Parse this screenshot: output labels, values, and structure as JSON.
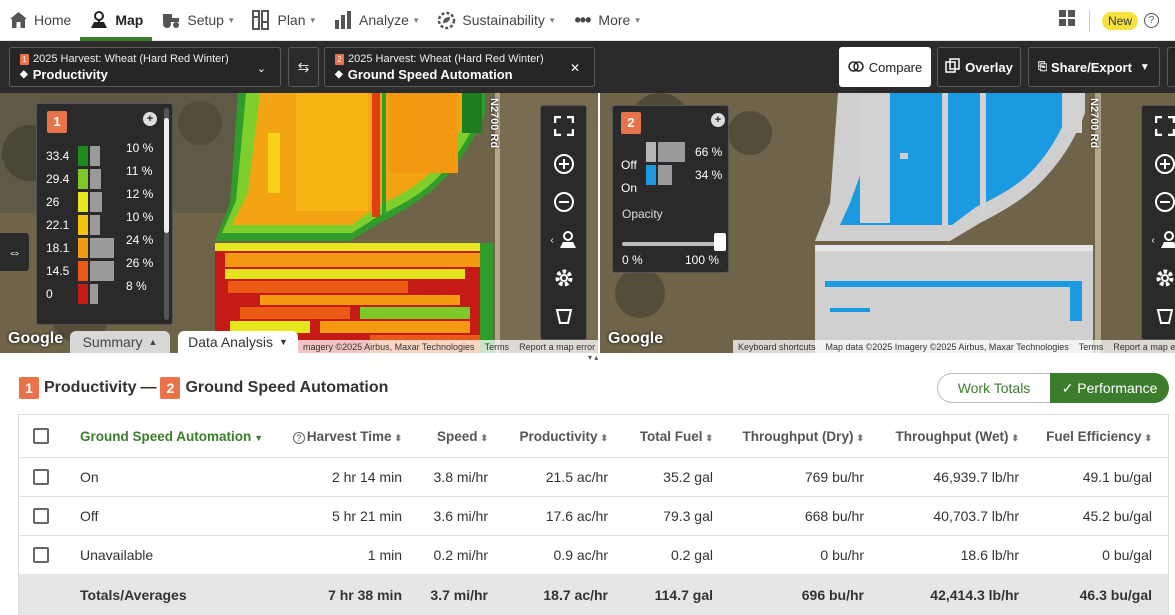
{
  "nav": {
    "items": [
      {
        "label": "Home",
        "icon": "home-icon"
      },
      {
        "label": "Map",
        "icon": "map-pin-icon"
      },
      {
        "label": "Setup",
        "icon": "tractor-icon"
      },
      {
        "label": "Plan",
        "icon": "columns-icon"
      },
      {
        "label": "Analyze",
        "icon": "bar-chart-icon"
      },
      {
        "label": "Sustainability",
        "icon": "leaf-gear-icon"
      },
      {
        "label": "More",
        "icon": "dots-icon"
      }
    ],
    "new_badge": "New"
  },
  "toolbar": {
    "layer1": {
      "num": "1",
      "title": "2025 Harvest: Wheat (Hard Red Winter)",
      "layer": "Productivity"
    },
    "layer2": {
      "num": "2",
      "title": "2025 Harvest: Wheat (Hard Red Winter)",
      "layer": "Ground Speed Automation"
    },
    "compare": "Compare",
    "overlay": "Overlay",
    "share": "Share/Export"
  },
  "map_left": {
    "legend_num": "1",
    "legend": [
      {
        "value": "33.4",
        "pct": "10 %",
        "color": "#1e8a1e",
        "fill": 0.42
      },
      {
        "value": "29.4",
        "pct": "11 %",
        "color": "#7ec82a",
        "fill": 0.46
      },
      {
        "value": "26",
        "pct": "12 %",
        "color": "#e6e61e",
        "fill": 0.5
      },
      {
        "value": "22.1",
        "pct": "10 %",
        "color": "#f2c20f",
        "fill": 0.42
      },
      {
        "value": "18.1",
        "pct": "24 %",
        "color": "#f39a12",
        "fill": 1.0
      },
      {
        "value": "14.5",
        "pct": "26 %",
        "color": "#ea5a14",
        "fill": 1.0
      },
      {
        "value": "0",
        "pct": "8 %",
        "color": "#c41b14",
        "fill": 0.33
      }
    ],
    "road": "N2700 Rd",
    "google": "Google",
    "attribution": [
      "magery ©2025 Airbus, Maxar Technologies",
      "Terms",
      "Report a map error"
    ]
  },
  "map_right": {
    "legend_num": "2",
    "legend": [
      {
        "label": "Off",
        "pct": "66 %",
        "color": "#b5b5b5",
        "fill": 1.0
      },
      {
        "label": "On",
        "pct": "34 %",
        "color": "#1a9ae0",
        "fill": 0.52
      }
    ],
    "opacity_label": "Opacity",
    "opacity_min": "0 %",
    "opacity_max": "100 %",
    "opacity_value": 1.0,
    "road": "N2700 Rd",
    "google": "Google",
    "attribution": [
      "Keyboard shortcuts",
      "Map data ©2025 Imagery ©2025 Airbus, Maxar Technologies",
      "Terms",
      "Report a map error"
    ]
  },
  "tabs": {
    "summary": "Summary",
    "data_analysis": "Data Analysis"
  },
  "compare": {
    "num1": "1",
    "label1": "Productivity",
    "dash": "—",
    "num2": "2",
    "label2": "Ground Speed Automation",
    "work_totals": "Work Totals",
    "performance": "✓ Performance"
  },
  "table": {
    "headers": [
      "Ground Speed Automation",
      "Harvest Time",
      "Speed",
      "Productivity",
      "Total Fuel",
      "Throughput (Dry)",
      "Throughput (Wet)",
      "Fuel Efficiency"
    ],
    "rows": [
      [
        "On",
        "2 hr 14 min",
        "3.8 mi/hr",
        "21.5 ac/hr",
        "35.2 gal",
        "769 bu/hr",
        "46,939.7 lb/hr",
        "49.1 bu/gal"
      ],
      [
        "Off",
        "5 hr 21 min",
        "3.6 mi/hr",
        "17.6 ac/hr",
        "79.3 gal",
        "668 bu/hr",
        "40,703.7 lb/hr",
        "45.2 bu/gal"
      ],
      [
        "Unavailable",
        "1 min",
        "0.2 mi/hr",
        "0.9 ac/hr",
        "0.2 gal",
        "0 bu/hr",
        "18.6 lb/hr",
        "0 bu/gal"
      ]
    ],
    "total": [
      "Totals/Averages",
      "7 hr 38 min",
      "3.7 mi/hr",
      "18.7 ac/hr",
      "114.7 gal",
      "696 bu/hr",
      "42,414.3 lb/hr",
      "46.3 bu/gal"
    ]
  }
}
